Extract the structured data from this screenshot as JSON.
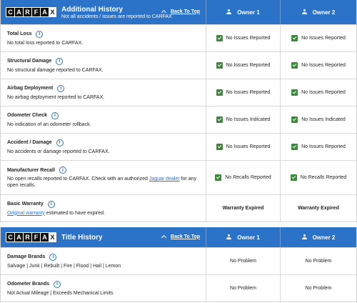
{
  "additional_history": {
    "title": "Additional History",
    "subtitle": "Not all accidents / issues are reported to CARFAX",
    "back_to_top": "Back To Top",
    "owner1": "Owner 1",
    "owner2": "Owner 2",
    "rows": [
      {
        "label": "Total Loss",
        "desc": "No total loss reported to CARFAX.",
        "o1": "No Issues Reported",
        "o2": "No Issues Reported"
      },
      {
        "label": "Structural Damage",
        "desc": "No structural damage reported to CARFAX.",
        "o1": "No Issues Reported",
        "o2": "No Issues Reported"
      },
      {
        "label": "Airbag Deployment",
        "desc": "No airbag deployment reported to CARFAX.",
        "o1": "No Issues Reported",
        "o2": "No Issues Reported"
      },
      {
        "label": "Odometer Check",
        "desc": "No indication of an odometer rollback.",
        "o1": "No Issues Indicated",
        "o2": "No Issues Indicated"
      },
      {
        "label": "Accident / Damage",
        "desc": "No accidents or damage reported to CARFAX.",
        "o1": "No Issues Reported",
        "o2": "No Issues Reported"
      },
      {
        "label": "Manufacturer Recall",
        "desc_pre": "No open recalls reported to CARFAX. Check with an authorized ",
        "desc_link": "Jaguar dealer",
        "desc_post": " for any open recalls.",
        "o1": "No Recalls Reported",
        "o2": "No Recalls Reported"
      },
      {
        "label": "Basic Warranty",
        "desc_link": "Original warranty",
        "desc_post": " estimated to have expired.",
        "o1": "Warranty Expired",
        "o2": "Warranty Expired"
      }
    ]
  },
  "title_history": {
    "title": "Title History",
    "back_to_top": "Back To Top",
    "owner1": "Owner 1",
    "owner2": "Owner 2",
    "rows": [
      {
        "label": "Damage Brands",
        "desc": "Salvage | Junk | Rebuilt | Fire | Flood | Hail | Lemon",
        "o1": "No Problem",
        "o2": "No Problem"
      },
      {
        "label": "Odometer Brands",
        "desc": "Not Actual Mileage | Exceeds Mechanical Limits",
        "o1": "No Problem",
        "o2": "No Problem"
      }
    ]
  },
  "logo": {
    "letters": [
      "C",
      "A",
      "R",
      "F",
      "A",
      "X"
    ]
  },
  "colors": {
    "header_blue": "#2b72c9",
    "check_green": "#3a8a3a",
    "link_blue": "#2b72c9"
  },
  "icons": {
    "info": "info-circle-icon",
    "check": "checkbox-checked-icon",
    "person": "person-icon",
    "caret": "chevron-up-icon"
  }
}
